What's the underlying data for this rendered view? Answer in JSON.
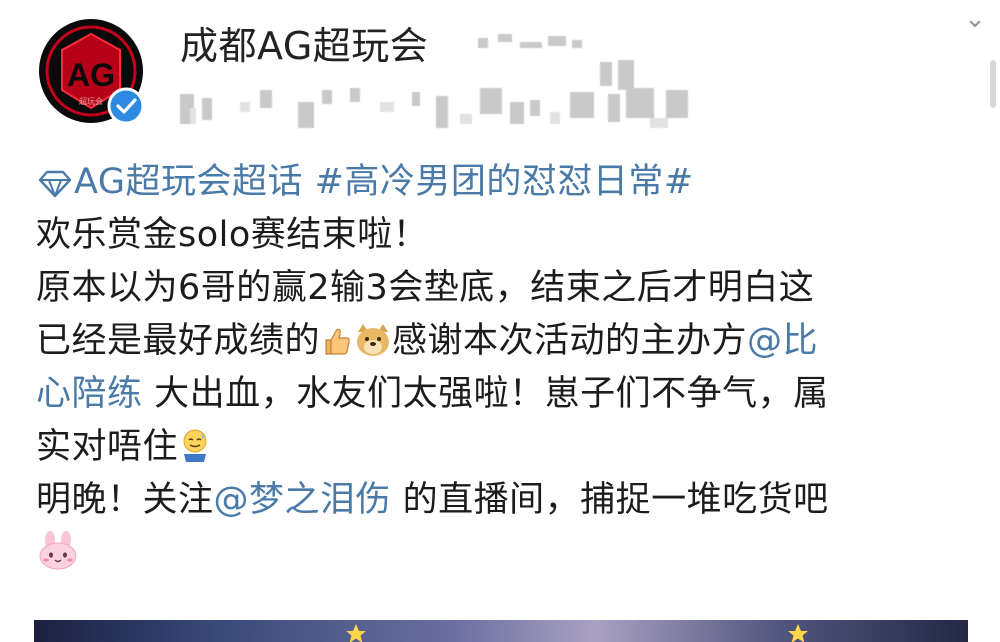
{
  "post": {
    "author": {
      "name": "成都AG超玩会",
      "avatar_label": "AG",
      "verified": true
    },
    "topic": {
      "supertopic": "AG超玩会超话",
      "hashtag": "#高冷男团的怼怼日常#"
    },
    "lines": {
      "l2": "欢乐赏金solo赛结束啦！",
      "l3": "原本以为6哥的赢2输3会垫底，结束之后才明白这",
      "l4_a": "已经是最好成绩的",
      "l4_b": "感谢本次活动的主办方",
      "l4_mention": "@比",
      "l5_mention": "心陪练",
      "l5_b": " 大出血，水友们太强啦！崽子们不争气，属",
      "l6": "实对唔住",
      "l7_a": "明晚！关注",
      "l7_mention": "@梦之泪伤",
      "l7_b": " 的直播间，捕捉一堆吃货吧"
    },
    "emojis": [
      "thumbs-up",
      "doge",
      "sweat-smile",
      "pink-bunny"
    ]
  },
  "colors": {
    "link": "#4a7aa8",
    "text": "#1c1c1c",
    "avatar_red": "#d0021b",
    "verified_blue": "#2d8ae0"
  }
}
